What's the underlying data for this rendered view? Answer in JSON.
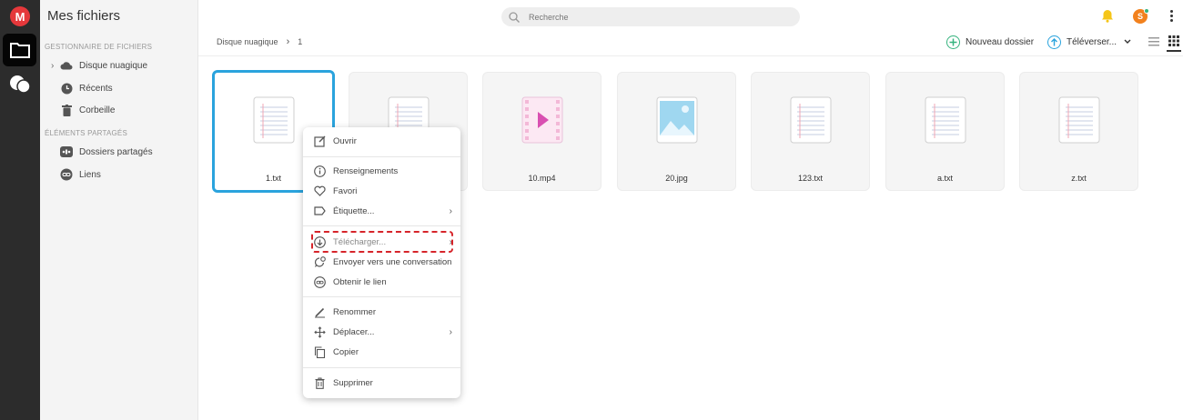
{
  "app": {
    "title": "Mes fichiers",
    "logo": "M"
  },
  "sidebar": {
    "section_files": "Gestionnaire de fichiers",
    "section_shared": "Éléments partagés",
    "items": [
      {
        "label": "Disque nuagique",
        "icon": "cloud-icon"
      },
      {
        "label": "Récents",
        "icon": "clock-icon"
      },
      {
        "label": "Corbeille",
        "icon": "trash-icon"
      },
      {
        "label": "Dossiers partagés",
        "icon": "shared-folder-icon"
      },
      {
        "label": "Liens",
        "icon": "link-icon"
      }
    ]
  },
  "search": {
    "placeholder": "Recherche"
  },
  "user": {
    "avatar_letter": "S"
  },
  "breadcrumb": {
    "root": "Disque nuagique",
    "current": "1"
  },
  "toolbar": {
    "new_folder": "Nouveau dossier",
    "upload": "Téléverser..."
  },
  "files": [
    {
      "name": "1.txt",
      "type": "text"
    },
    {
      "name": "",
      "type": "text"
    },
    {
      "name": "10.mp4",
      "type": "video"
    },
    {
      "name": "20.jpg",
      "type": "image"
    },
    {
      "name": "123.txt",
      "type": "text"
    },
    {
      "name": "a.txt",
      "type": "text"
    },
    {
      "name": "z.txt",
      "type": "text"
    }
  ],
  "context_menu": {
    "open": "Ouvrir",
    "info": "Renseignements",
    "favorite": "Favori",
    "label": "Étiquette...",
    "download": "Télécharger...",
    "send_to_chat": "Envoyer vers une conversation",
    "get_link": "Obtenir le lien",
    "rename": "Renommer",
    "move": "Déplacer...",
    "copy": "Copier",
    "delete": "Supprimer"
  },
  "colors": {
    "accent": "#2aa3dd",
    "brand": "#e5383b",
    "highlight": "#d6242a",
    "green": "#36b37e"
  }
}
